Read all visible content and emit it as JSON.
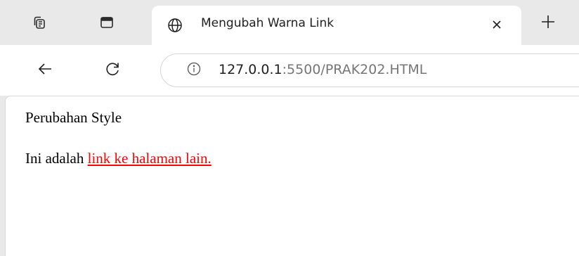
{
  "browser": {
    "tab": {
      "title": "Mengubah Warna Link",
      "favicon_icon": "globe-icon",
      "close_icon": "close-icon"
    },
    "tabstrip": {
      "workspaces_icon": "workspaces-icon",
      "tab_actions_icon": "tab-actions-icon",
      "new_tab_icon": "plus-icon"
    },
    "toolbar": {
      "back_icon": "arrow-left-icon",
      "refresh_icon": "refresh-icon",
      "site_info_icon": "info-icon",
      "url_host": "127.0.0.1",
      "url_rest": ":5500/PRAK202.HTML"
    }
  },
  "page": {
    "heading": "Perubahan Style",
    "paragraph_prefix": "Ini adalah ",
    "link_text": "link ke halaman lain.",
    "link_color": "#ff0000"
  },
  "colors": {
    "frame_bg": "#e9e9e9",
    "page_bg": "#ffffff",
    "url_host_color": "#1f1f1f",
    "url_rest_color": "#767676"
  }
}
